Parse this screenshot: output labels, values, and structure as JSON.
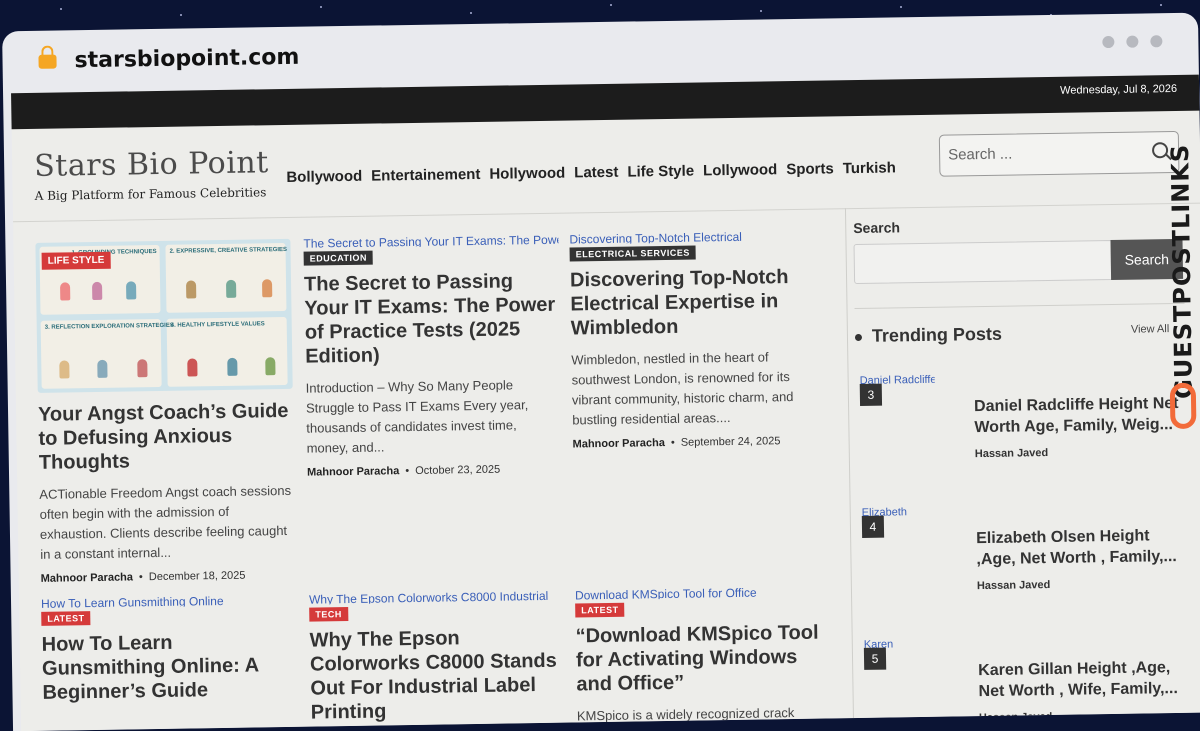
{
  "browser": {
    "url": "starsbiopoint.com"
  },
  "topbar": {
    "date": "Wednesday, Jul 8, 2026"
  },
  "site": {
    "name": "Stars Bio Point",
    "tagline": "A Big Platform for Famous Celebrities"
  },
  "nav": [
    "Bollywood",
    "Entertainement",
    "Hollywood",
    "Latest",
    "Life Style",
    "Lollywood",
    "Sports",
    "Turkish"
  ],
  "header_search": {
    "placeholder": "Search ..."
  },
  "posts": [
    {
      "category": "LIFE STYLE",
      "title": "Your Angst Coach’s Guide to Defusing Anxious Thoughts",
      "excerpt": "ACTionable Freedom Angst coach sessions often begin with the admission of exhaustion. Clients describe feeling caught in a constant internal...",
      "author": "Mahnoor Paracha",
      "date": "December 18, 2025",
      "infographic": [
        "1. GROUNDING TECHNIQUES",
        "2. EXPRESSIVE, CREATIVE STRATEGIES",
        "3. REFLECTION EXPLORATION STRATEGIES",
        "4. HEALTHY LIFESTYLE VALUES"
      ]
    },
    {
      "image_alt": "The Secret to Passing Your IT Exams: The Power of Practice",
      "category": "EDUCATION",
      "title": "The Secret to Passing Your IT Exams: The Power of Practice Tests (2025 Edition)",
      "excerpt": "Introduction – Why So Many People Struggle to Pass IT Exams Every year, thousands of candidates invest time, money, and...",
      "author": "Mahnoor Paracha",
      "date": "October 23, 2025"
    },
    {
      "image_alt": "Discovering Top-Notch Electrical",
      "category": "ELECTRICAL SERVICES",
      "title": "Discovering Top-Notch Electrical Expertise in Wimbledon",
      "excerpt": "Wimbledon, nestled in the heart of southwest London, is renowned for its vibrant community, historic charm, and bustling residential areas....",
      "author": "Mahnoor Paracha",
      "date": "September 24, 2025"
    },
    {
      "image_alt": "How To Learn Gunsmithing Online",
      "category": "LATEST",
      "title": "How To Learn Gunsmithing Online: A Beginner’s Guide"
    },
    {
      "image_alt": "Why The Epson Colorworks C8000 Industrial",
      "category": "TECH",
      "title": "Why The Epson Colorworks C8000 Stands Out For Industrial Label Printing"
    },
    {
      "image_alt": "Download KMSpico Tool for Office",
      "category": "LATEST",
      "title": "“Download KMSpico Tool for Activating Windows and Office”",
      "excerpt": "KMSpico is a widely recognized crack"
    }
  ],
  "sidebar": {
    "search_label": "Search",
    "search_button": "Search",
    "trending_title": "Trending Posts",
    "view_all": "View All",
    "trending": [
      {
        "rank": "3",
        "image_alt": "Daniel Radcliffe",
        "title": "Daniel Radcliffe Height Net Worth Age, Family, Weig...",
        "author": "Hassan Javed"
      },
      {
        "rank": "4",
        "image_alt": "Elizabeth",
        "title": "Elizabeth Olsen Height ,Age, Net Worth , Family,...",
        "author": "Hassan Javed"
      },
      {
        "rank": "5",
        "image_alt": "Karen",
        "title": "Karen Gillan Height ,Age, Net Worth , Wife, Family,...",
        "author": "Hassan Javed"
      }
    ]
  },
  "watermark": {
    "text": "GUESTPOSTLINKS"
  },
  "colors": {
    "accent_red": "#d53a3a",
    "dark": "#1c1c1c",
    "link_orange": "#f26b3a"
  }
}
